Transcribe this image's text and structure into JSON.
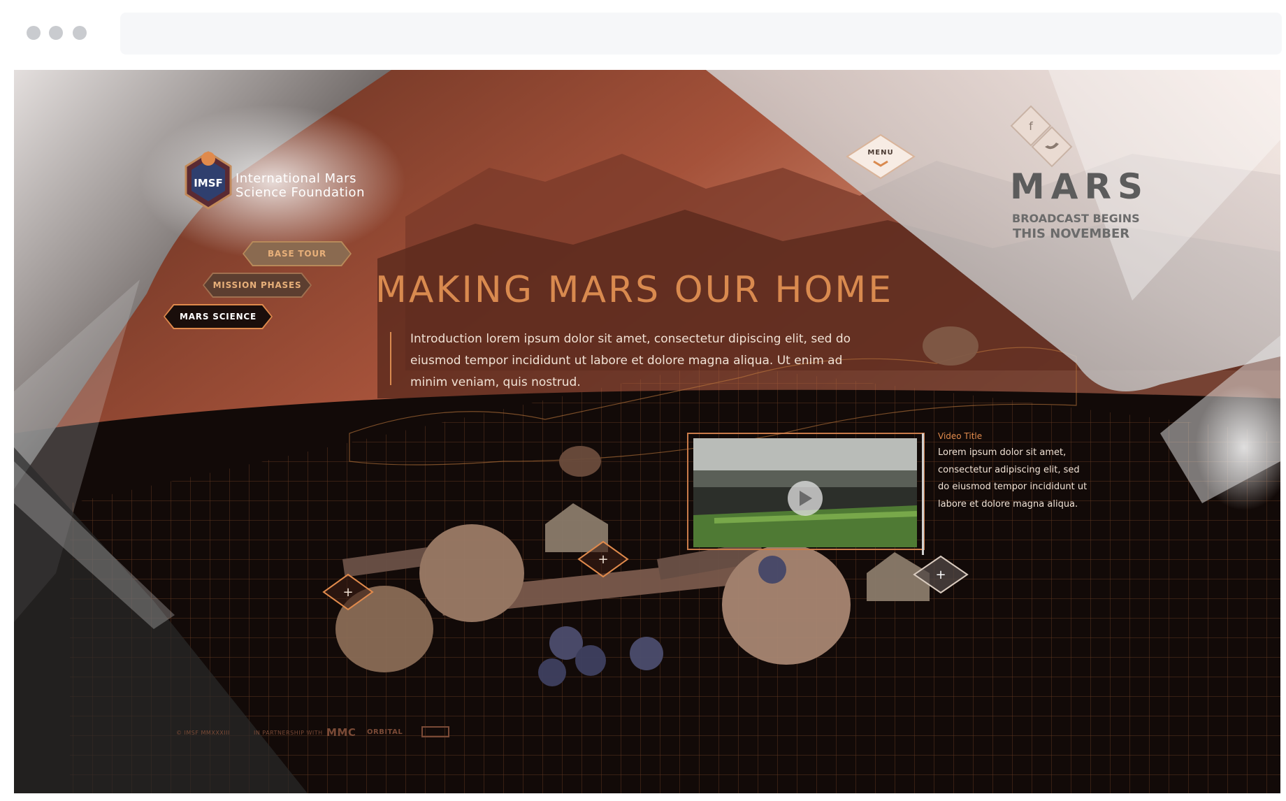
{
  "site": {
    "org_line1": "International Mars",
    "org_line2": "Science Foundation",
    "badge_left": "IM",
    "badge_right": "SF"
  },
  "nav": {
    "items": [
      {
        "label": "BASE TOUR"
      },
      {
        "label": "MISSION PHASES"
      },
      {
        "label": "MARS SCIENCE"
      }
    ],
    "active": "MARS SCIENCE"
  },
  "header": {
    "menu_label": "MENU",
    "social": [
      "facebook-icon",
      "twitter-icon"
    ]
  },
  "promo": {
    "title": "MARS",
    "line1": "BROADCAST BEGINS",
    "line2": "THIS NOVEMBER"
  },
  "hero": {
    "headline": "MAKING MARS OUR HOME",
    "intro": "Introduction lorem ipsum dolor sit amet, consectetur dipiscing elit, sed do eiusmod tempor incididunt ut labore et dolore magna aliqua. Ut enim ad minim veniam, quis nostrud."
  },
  "video": {
    "title": "Video Title",
    "description": "Lorem ipsum dolor sit amet, consectetur adipiscing elit, sed do eiusmod tempor incididunt ut labore et dolore magna aliqua.",
    "icon": "play-icon"
  },
  "hotspots": {
    "icon": "plus-icon",
    "label": "+"
  },
  "footer": {
    "copyright": "© IMSF MMXXXIII",
    "partnership": "IN PARTNERSHIP WITH",
    "partners": [
      "MMC",
      "ORBITAL"
    ]
  },
  "colors": {
    "accent": "#d98a4f",
    "text_light": "#f1e2d5",
    "brand_gray": "#5c5c5c"
  }
}
